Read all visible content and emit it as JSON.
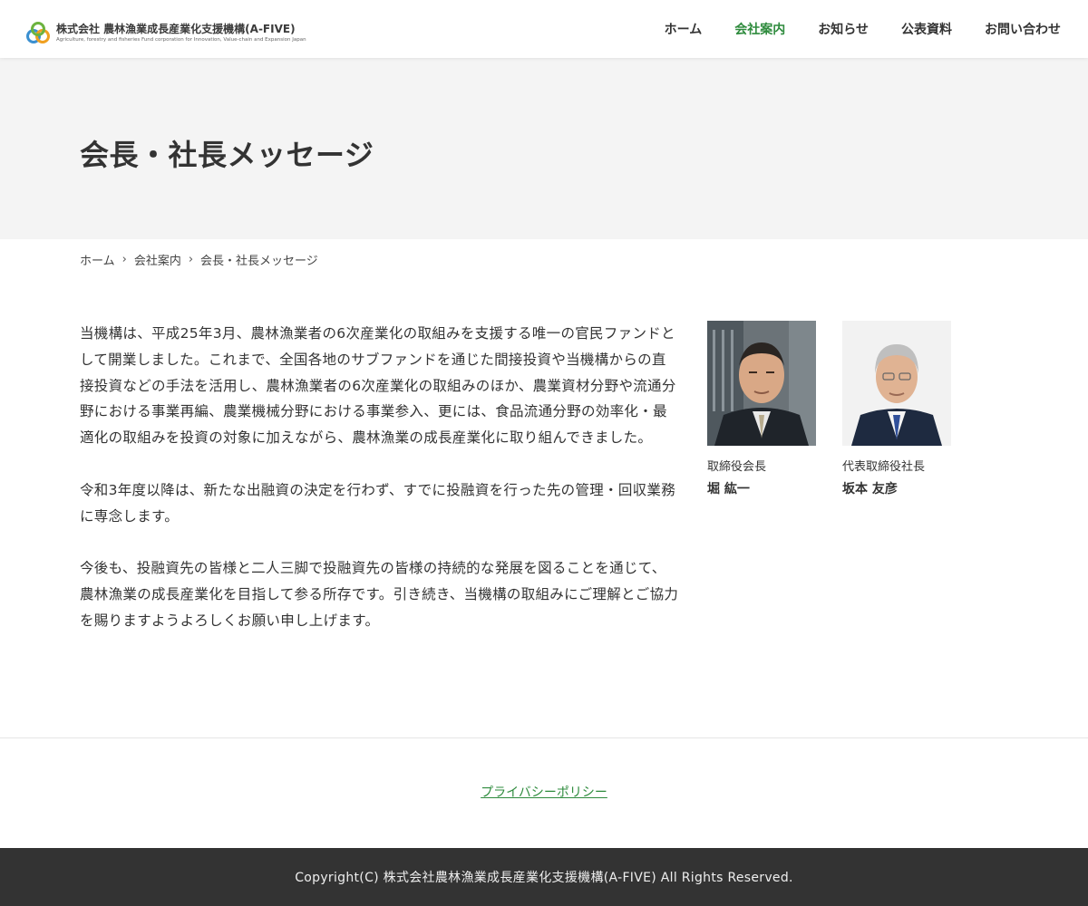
{
  "header": {
    "logo_title": "株式会社 農林漁業成長産業化支援機構(A-FIVE)",
    "logo_subtitle": "Agriculture, forestry and fisheries Fund corporation for Innovation, Value-chain and Expansion Japan",
    "nav": [
      {
        "label": "ホーム",
        "active": false
      },
      {
        "label": "会社案内",
        "active": true
      },
      {
        "label": "お知らせ",
        "active": false
      },
      {
        "label": "公表資料",
        "active": false
      },
      {
        "label": "お問い合わせ",
        "active": false
      }
    ]
  },
  "page_title": "会長・社長メッセージ",
  "breadcrumb": [
    "ホーム",
    "会社案内",
    "会長・社長メッセージ"
  ],
  "message": {
    "paragraphs": [
      "当機構は、平成25年3月、農林漁業者の6次産業化の取組みを支援する唯一の官民ファンドとして開業しました。これまで、全国各地のサブファンドを通じた間接投資や当機構からの直接投資などの手法を活用し、農林漁業者の6次産業化の取組みのほか、農業資材分野や流通分野における事業再編、農業機械分野における事業参入、更には、食品流通分野の効率化・最適化の取組みを投資の対象に加えながら、農林漁業の成長産業化に取り組んできました。",
      "令和3年度以降は、新たな出融資の決定を行わず、すでに投融資を行った先の管理・回収業務に専念します。",
      "今後も、投融資先の皆様と二人三脚で投融資先の皆様の持続的な発展を図ることを通じて、農林漁業の成長産業化を目指して参る所存です。引き続き、当機構の取組みにご理解とご協力を賜りますようよろしくお願い申し上げます。"
    ]
  },
  "people": [
    {
      "role": "取締役会長",
      "name": "堀 紘一"
    },
    {
      "role": "代表取締役社長",
      "name": "坂本 友彦"
    }
  ],
  "footer": {
    "privacy_link": "プライバシーポリシー",
    "copyright": "Copyright(C) 株式会社農林漁業成長産業化支援機構(A-FIVE) All Rights Reserved."
  },
  "colors": {
    "accent": "#2e8b3d",
    "title_band": "#f4f4f4",
    "footer_bg": "#333333"
  }
}
